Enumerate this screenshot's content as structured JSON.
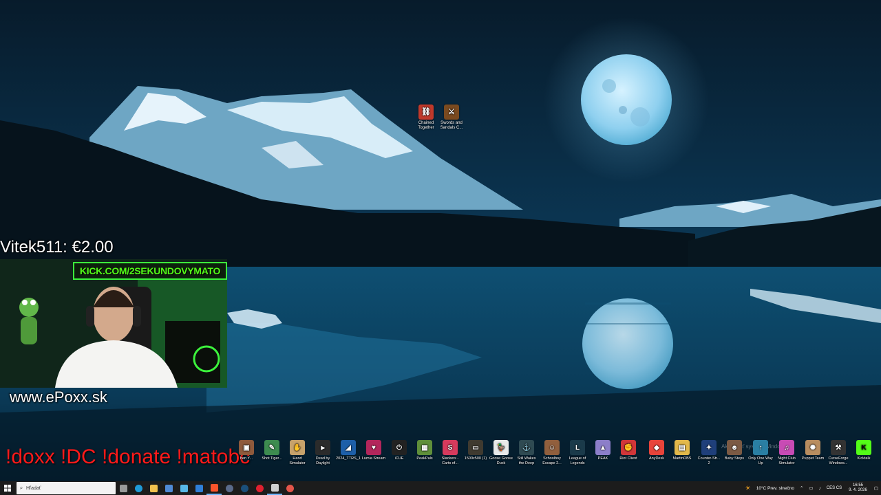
{
  "desktop": {
    "top_icons": [
      {
        "label": "Chained Together",
        "color": "#c0392b",
        "glyph": "⛓"
      },
      {
        "label": "Swords and Sandals C...",
        "color": "#7a4a1f",
        "glyph": "⚔"
      }
    ],
    "bottom_icons": [
      {
        "label": "hen Y...",
        "color": "#8e5a3c",
        "glyph": "▣"
      },
      {
        "label": "Shot Tiger...",
        "color": "#3d8b4f",
        "glyph": "✎"
      },
      {
        "label": "Hand Simulator",
        "color": "#c7a26b",
        "glyph": "✋"
      },
      {
        "label": "Dead by Daylight",
        "color": "#2b2b2b",
        "glyph": "⫸"
      },
      {
        "label": "2024_TTRS_1",
        "color": "#1d5fa8",
        "glyph": "◢"
      },
      {
        "label": "Lumia Stream",
        "color": "#b3265b",
        "glyph": "♥"
      },
      {
        "label": "iCUE",
        "color": "#222222",
        "glyph": "⏻"
      },
      {
        "label": "PeakPals",
        "color": "#5f8f3a",
        "glyph": "▦"
      },
      {
        "label": "Slackers - Carts of...",
        "color": "#d63a5d",
        "glyph": "S"
      },
      {
        "label": "1500x500 (1)",
        "color": "#3f3a30",
        "glyph": "▭"
      },
      {
        "label": "Goose Goose Duck",
        "color": "#e9e9e9",
        "glyph": "🦆"
      },
      {
        "label": "Still Wakes the Deep",
        "color": "#2f4a52",
        "glyph": "⚓"
      },
      {
        "label": "Schoolboy Escape 2...",
        "color": "#915f3d",
        "glyph": "☺"
      },
      {
        "label": "League of Legends",
        "color": "#1a3a4a",
        "glyph": "L"
      },
      {
        "label": "PEAK",
        "color": "#8c7ec9",
        "glyph": "▲"
      },
      {
        "label": "Riot Client",
        "color": "#d13639",
        "glyph": "✊"
      },
      {
        "label": "AnyDesk",
        "color": "#e8443a",
        "glyph": "◆"
      },
      {
        "label": "MartinOBS",
        "color": "#e2b84a",
        "glyph": "▤"
      },
      {
        "label": "Counter-Str... 2",
        "color": "#1f3f7a",
        "glyph": "✦"
      },
      {
        "label": "Baby Steps",
        "color": "#7b5a44",
        "glyph": "☻"
      },
      {
        "label": "Only One Way Up",
        "color": "#2a7fa3",
        "glyph": "↑"
      },
      {
        "label": "Night Club Simulator",
        "color": "#c84bb4",
        "glyph": "♫"
      },
      {
        "label": "Puppet Team",
        "color": "#b88d5f",
        "glyph": "✺"
      },
      {
        "label": "CurseForge Windows...",
        "color": "#333333",
        "glyph": "⚒"
      },
      {
        "label": "Kicktalk",
        "color": "#53fc18",
        "glyph": "K"
      }
    ]
  },
  "overlay": {
    "donation": "Vitek511: €2.00",
    "kick_banner": "KICK.COM/2SEKUNDOVYMATO",
    "website": "www.ePoxx.sk",
    "commands": "!doxx  !DC !donate !matobc",
    "activate_watermark": "Aktivovať systém Windows"
  },
  "taskbar": {
    "search_placeholder": "Hľadať",
    "apps": [
      {
        "name": "task-view-icon",
        "color": "#9a9a9a"
      },
      {
        "name": "edge-icon",
        "color": "#1f9ad6"
      },
      {
        "name": "file-explorer-icon",
        "color": "#f2c14e"
      },
      {
        "name": "store-icon",
        "color": "#4f8ad6"
      },
      {
        "name": "photos-icon",
        "color": "#58b7e6"
      },
      {
        "name": "mail-icon",
        "color": "#2f7fd8"
      },
      {
        "name": "brave-icon",
        "color": "#fb542b"
      },
      {
        "name": "obs-icon",
        "color": "#5a6a8a"
      },
      {
        "name": "steam-icon",
        "color": "#1b4f7a"
      },
      {
        "name": "opera-icon",
        "color": "#e0202f"
      },
      {
        "name": "app-icon",
        "color": "#cfcfcf"
      },
      {
        "name": "recorder-icon",
        "color": "#e3554a"
      }
    ],
    "weather": "10°C  Prev. slnečno",
    "language": "CES CS",
    "time": "16:55",
    "date": "9. 4. 2026"
  }
}
